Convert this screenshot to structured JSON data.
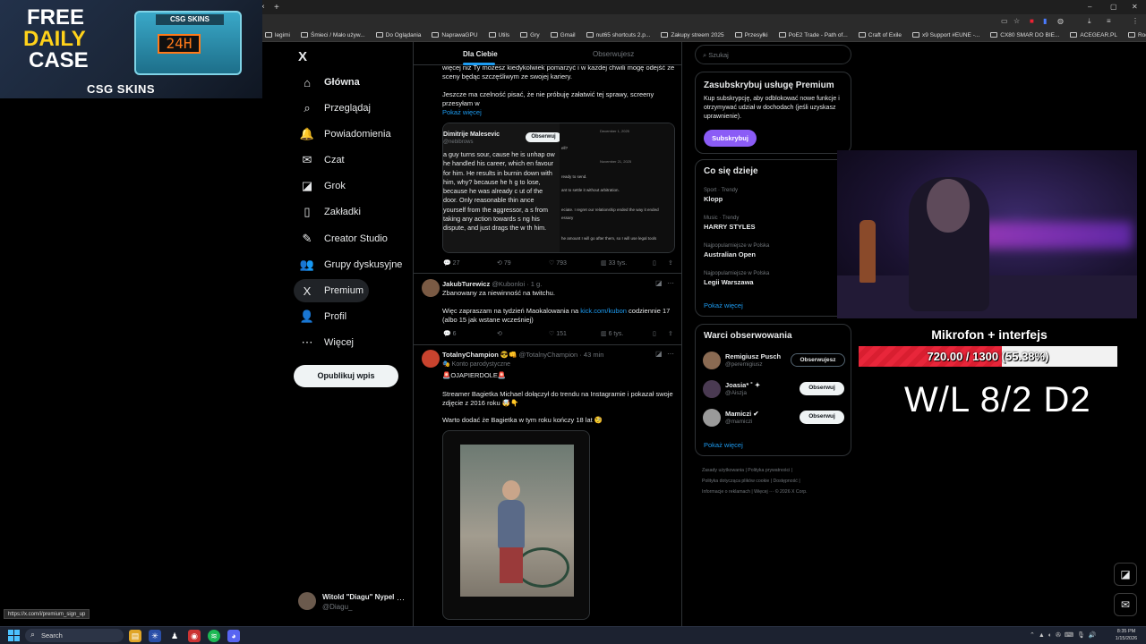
{
  "browser": {
    "bookmarks": [
      "legimi",
      "Śmieci / Mało używ...",
      "Do Oglądania",
      "NaprawaGPU",
      "Utils",
      "Gry",
      "Gmail",
      "nut65 shortcuts 2.p...",
      "Zakupy streem 2025",
      "Przesyłki",
      "PoE2 Trade - Path of...",
      "Craft of Exile",
      "x9 Support #EUNE -...",
      "CX80 SMAR DO BIE...",
      "ACEGEAR.PL",
      "Rode RODE NT1S-A..."
    ],
    "new_tab": "+",
    "tab_close": "×",
    "status_url": "https://x.com/i/premium_sign_up"
  },
  "ad": {
    "line1": "FREE",
    "line2": "DAILY",
    "line3": "CASE",
    "case_label": "CSG SKINS",
    "timer": "24H",
    "brand": "CSG SKINS"
  },
  "nav": {
    "logo": "X",
    "items": [
      {
        "label": "Główna",
        "icon": "⌂"
      },
      {
        "label": "Przeglądaj",
        "icon": "⌕"
      },
      {
        "label": "Powiadomienia",
        "icon": "🔔"
      },
      {
        "label": "Czat",
        "icon": "✉"
      },
      {
        "label": "Grok",
        "icon": "◪"
      },
      {
        "label": "Zakładki",
        "icon": "▯"
      },
      {
        "label": "Creator Studio",
        "icon": "✎"
      },
      {
        "label": "Grupy dyskusyjne",
        "icon": "👥"
      },
      {
        "label": "Premium",
        "icon": "X"
      },
      {
        "label": "Profil",
        "icon": "👤"
      },
      {
        "label": "Więcej",
        "icon": "⋯"
      }
    ],
    "publish": "Opublikuj wpis",
    "account": {
      "name": "Witold \"Diagu\" Nypel",
      "handle": "@Diagu_",
      "more": "⋯"
    }
  },
  "feed": {
    "tabs": {
      "for_you": "Dla Ciebie",
      "following": "Obserwujesz"
    },
    "post1": {
      "text_a": "więcej niż Ty możesz kiedykolwiek pomarzyć i w każdej chwili mogę odejść ze sceny będąc szczęśliwym ze swojej kariery.",
      "text_b": "Jeszcze ma czelność pisać, że nie próbuję załatwić tej sprawy, screeny przesyłam w",
      "show_more": "Pokaż więcej",
      "quote": {
        "name": "Dimitrije Malesevic",
        "handle": "@nebibrows",
        "follow": "Obserwuj",
        "body": "a guy turns sour, cause he is unhap ow he handled his career, which en favour for him. He results in burnin down with him, why? because he h g to lose, because he was already c ut of the door. Only reasonable thin ance yourself from the aggressor, a s from taking any action towards s ng his dispute, and just drags the w th him.",
        "right_lines": [
          "December 1, 2025",
          "ell?",
          "November 21, 2025",
          "ready to send.",
          "ant to settle it without arbitration.",
          "eciate. I regret our relationship ended the way it ended",
          "essary",
          "he amount I will go after them, so I will use legal tools"
        ]
      },
      "stats": {
        "replies": "27",
        "reposts": "79",
        "likes": "793",
        "views": "33 tys."
      }
    },
    "post2": {
      "name": "JakubTurewicz",
      "handle": "@Kubonloi",
      "time": "· 1 g.",
      "line1": "Zbanowany za niewinność na twitchu.",
      "line2_pre": "Więc zapraszam na tydzień Maokalowania na ",
      "link": "kick.com/kubon",
      "line2_post": " codziennie 17 (albo 15 jak wstane wcześniej)",
      "stats": {
        "replies": "6",
        "reposts": "",
        "likes": "151",
        "views": "6 tys."
      }
    },
    "post3": {
      "name": "TotalnyChampion 😎👊",
      "handle": "@TotalnyChampion",
      "time": "· 43 min",
      "badge": "🎭 Konto parodystyczne",
      "line1": "🚨OJAPIERDOLE🚨",
      "line2": "Streamer Bagietka Michael dołączył do trendu na Instagramie i pokazał swoje zdjęcie z 2016 roku 🤯👇",
      "line3": "Warto dodać że Bagietka w tym roku kończy 18 lat 🧐"
    }
  },
  "right": {
    "search_placeholder": "Szukaj",
    "premium": {
      "title": "Zasubskrybuj usługę Premium",
      "desc": "Kup subskrypcję, aby odblokować nowe funkcje i otrzymywać udział w dochodach (jeśli uzyskasz uprawnienie).",
      "button": "Subskrybuj"
    },
    "trends": {
      "title": "Co się dzieje",
      "items": [
        {
          "cat": "Sport · Trendy",
          "name": "Klopp"
        },
        {
          "cat": "Music · Trendy",
          "name": "HARRY STYLES"
        },
        {
          "cat": "Najpopularniejsze w Polska",
          "name": "Australian Open"
        },
        {
          "cat": "Najpopularniejsze w Polska",
          "name": "Legii Warszawa"
        }
      ],
      "show_more": "Pokaż więcej"
    },
    "follow": {
      "title": "Warci obserwowania",
      "items": [
        {
          "name": "Remigiusz Pusch",
          "handle": "@peremigiusz",
          "button": "Obserwujesz"
        },
        {
          "name": "Joasia* ˚ ✦",
          "handle": "@Aiszja",
          "button": "Obserwuj"
        },
        {
          "name": "Mamiczi ✔",
          "handle": "@mamiczi",
          "button": "Obserwuj"
        }
      ],
      "show_more": "Pokaż więcej"
    },
    "footer": {
      "l1": "Zasady użytkowania  |  Polityka prywatności  |",
      "l2": "Polityka dotycząca plików cookie  |  Dostępność  |",
      "l3": "Informacje o reklamach  |  Więcej ···  © 2026 X Corp."
    }
  },
  "stream": {
    "mic_label": "Mikrofon + interfejs",
    "progress_text": "720.00 / 1300 (55.38%)",
    "progress_fraction": 0.5538,
    "wl": "W/L 8/2 D2"
  },
  "taskbar": {
    "search": "Search",
    "time": "8:35 PM",
    "date": "1/15/2026"
  }
}
